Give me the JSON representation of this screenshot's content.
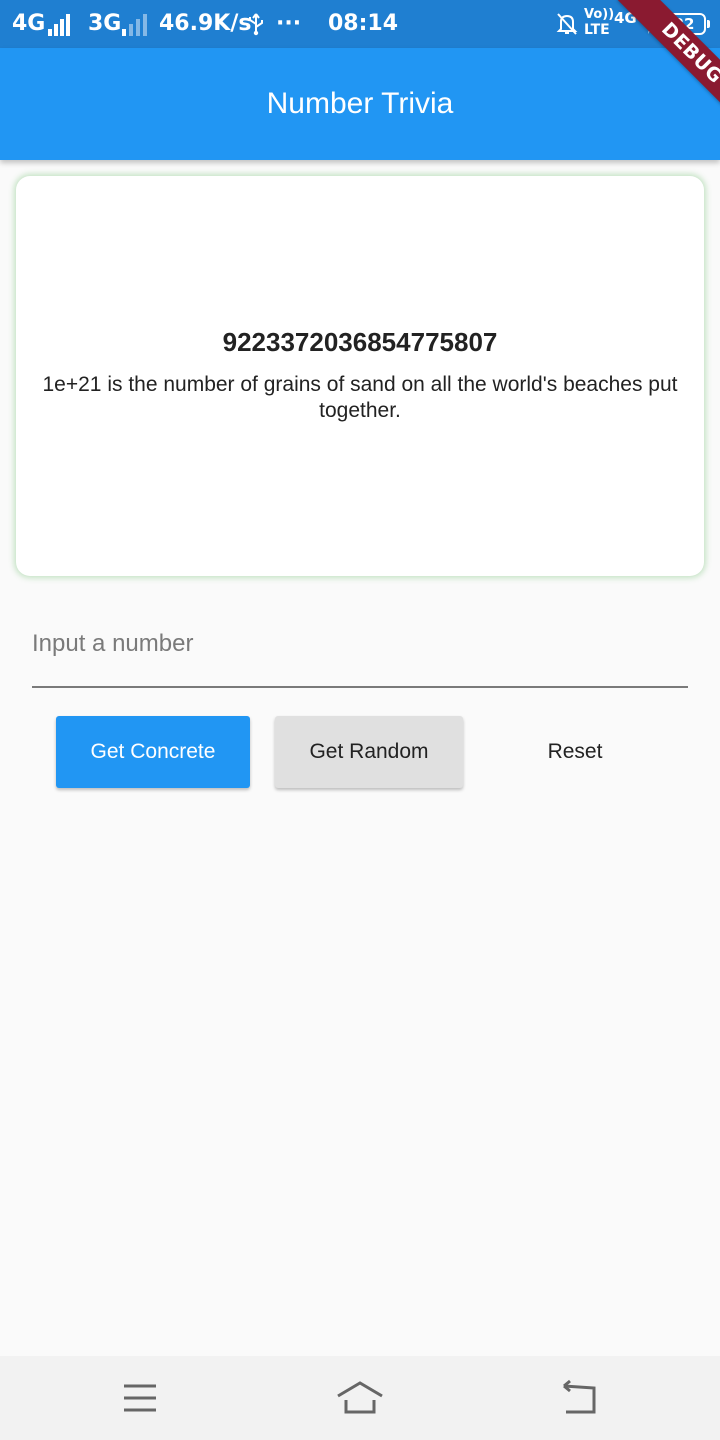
{
  "status_bar": {
    "network1": "4G",
    "network2": "3G",
    "speed": "46.9K/s",
    "more": "···",
    "time": "08:14",
    "volte_top": "Vo))",
    "volte_bottom": "LTE",
    "network3": "4G",
    "battery": "22",
    "usb_icon": "usb-icon",
    "mute_icon": "bell-off-icon",
    "charge_icon": "lightning-icon"
  },
  "debug_ribbon": "DEBUG",
  "app_bar": {
    "title": "Number Trivia",
    "color": "#2196f3"
  },
  "trivia": {
    "number": "9223372036854775807",
    "text": "1e+21 is the number of grains of sand on all the world's beaches put together."
  },
  "input": {
    "value": "",
    "placeholder": "Input a number"
  },
  "buttons": {
    "concrete": "Get Concrete",
    "random": "Get Random",
    "reset": "Reset"
  },
  "nav_bar": {
    "menu_icon": "menu-icon",
    "home_icon": "home-icon",
    "back_icon": "back-icon"
  }
}
